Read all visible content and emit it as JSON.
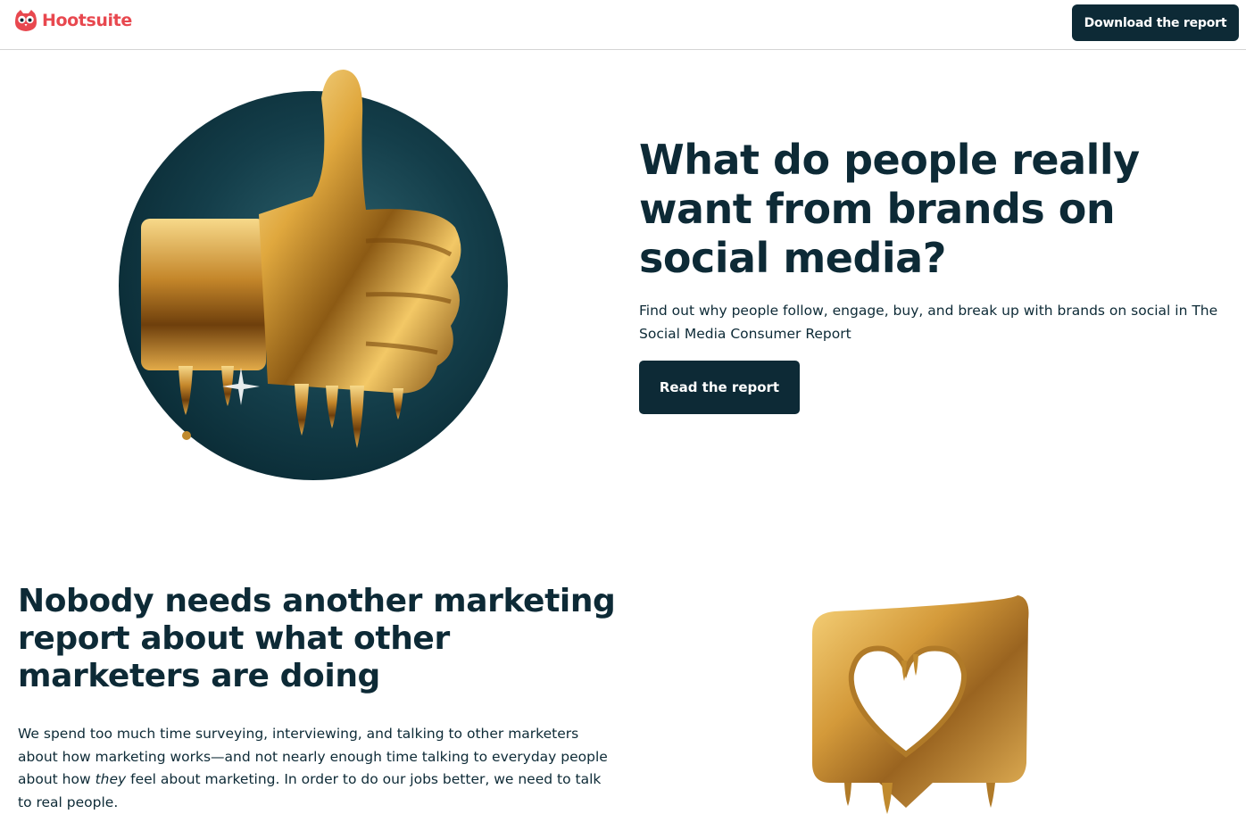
{
  "header": {
    "brand": "Hootsuite",
    "download_label": "Download the report"
  },
  "hero": {
    "title": "What do people really want from brands on social media?",
    "subtitle": "Find out why people follow, engage, buy, and break up with brands on social in The Social Media Consumer Report",
    "cta_label": "Read the report"
  },
  "section2": {
    "title": "Nobody needs another marketing report about what other marketers are doing",
    "body_before": "We spend too much time surveying, interviewing, and talking to other marketers about how marketing works—and not nearly enough time talking to everyday people about how ",
    "body_em": "they",
    "body_after": " feel about marketing. In order to do our jobs better, we need to talk to real people."
  },
  "colors": {
    "brand_red": "#e8484f",
    "navy": "#0d2a36",
    "gold": "#d9a441"
  },
  "icons": {
    "logo": "owl-logo-icon",
    "hero_image": "gold-thumbs-up-image",
    "section2_image": "gold-heart-bubble-image"
  }
}
